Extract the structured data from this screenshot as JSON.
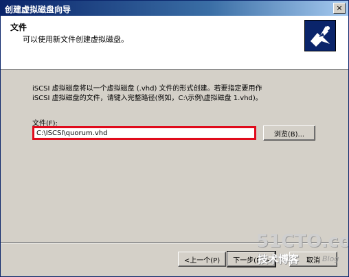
{
  "window": {
    "title": "创建虚拟磁盘向导",
    "close_label": "×"
  },
  "header": {
    "title": "文件",
    "subtitle": "可以使用新文件创建虚拟磁盘。",
    "icon": "wizard-disk-icon"
  },
  "body": {
    "description": "iSCSI 虚拟磁盘将以一个虚拟磁盘 (.vhd) 文件的形式创建。若要指定要用作\niSCSI 虚拟磁盘的文件，请键入完整路径(例如，C:\\示例\\虚拟磁盘 1.vhd)。",
    "file_label": "文件(F):",
    "file_value": "C:\\ISCSI\\quorum.vhd",
    "browse_label": "浏览(B)..."
  },
  "footer": {
    "back_label": "<上一个(P)",
    "next_label": "下一步(N)>",
    "cancel_label": "取消"
  },
  "watermark": {
    "main": "51CTO.com",
    "sub": "技术博客",
    "blog": "Blog"
  },
  "colors": {
    "highlight": "#e00b1c",
    "titlebar": "#0a246a"
  }
}
